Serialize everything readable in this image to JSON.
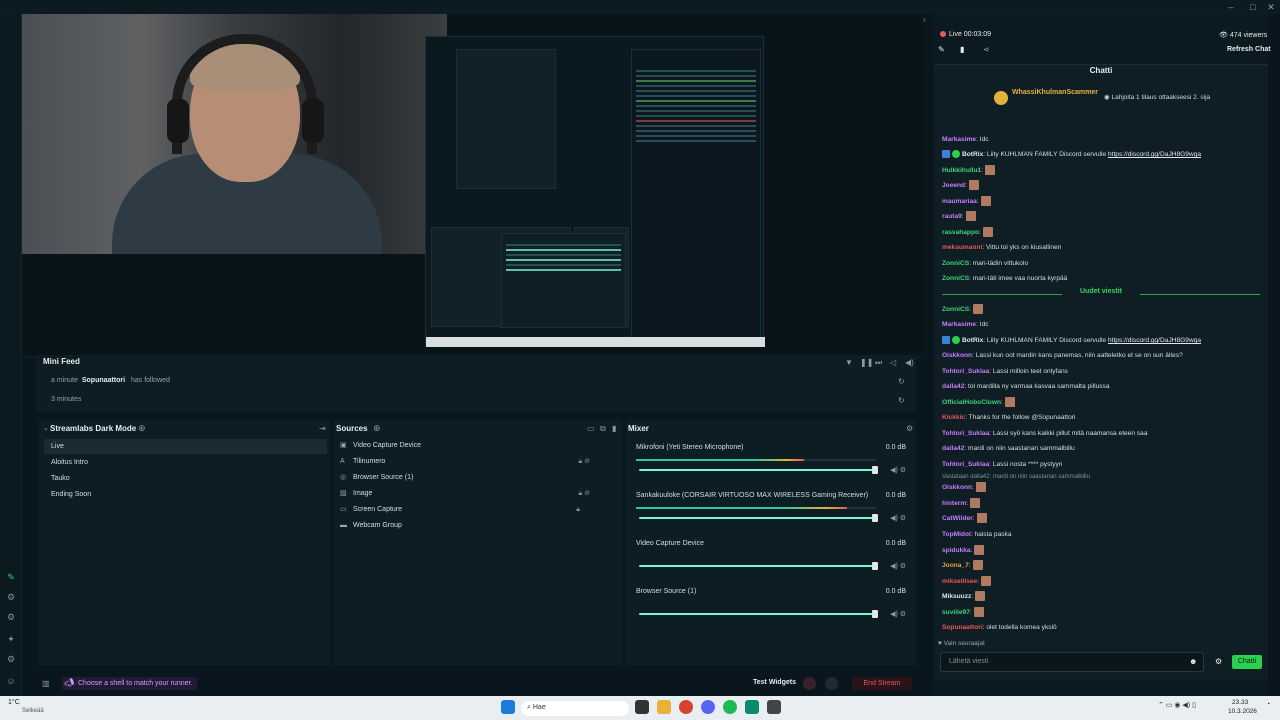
{
  "chat_header": {
    "live_status": "Live 00:03:09",
    "viewers": "474 viewers",
    "refresh": "Refresh Chat",
    "title": "Chatti"
  },
  "pinned": {
    "user": "WhassiKhulmanScammer",
    "message": "Lahjoita 1 tilaus ottaakseesi 2. sija"
  },
  "mini_feed": {
    "title": "Mini Feed",
    "rows": [
      {
        "time": "a minute",
        "user": "Sopunaattori",
        "event": "has followed"
      },
      {
        "time": "3 minutes",
        "user": "",
        "event": ""
      }
    ]
  },
  "scenes": {
    "title": "Streamlabs Dark Mode",
    "items": [
      "Live",
      "Aloitus Intro",
      "Tauko",
      "Ending Soon"
    ]
  },
  "sources": {
    "title": "Sources",
    "items": [
      "Video Capture Device",
      "Tilinumero",
      "Browser Source (1)",
      "Image",
      "Screen Capture",
      "Webcam Group"
    ]
  },
  "mixer": {
    "title": "Mixer",
    "channels": [
      {
        "name": "Mikrofoni (Yeti Stereo Microphone)",
        "db": "0.0 dB",
        "level": 0.7
      },
      {
        "name": "Sankakuuloke (CORSAIR VIRTUOSO MAX WIRELESS Gaming Receiver)",
        "db": "0.0 dB",
        "level": 0.88
      },
      {
        "name": "Video Capture Device",
        "db": "0.0 dB",
        "level": 0
      },
      {
        "name": "Browser Source (1)",
        "db": "0.0 dB",
        "level": 0
      }
    ]
  },
  "bottombar": {
    "tip": "Choose a shell to match your runner.",
    "test_widgets": "Test Widgets",
    "end_stream": "End Stream"
  },
  "chat": {
    "new_messages": "Uudet viestit",
    "lines_before": [
      {
        "user": "Markasime",
        "color": "#c77dff",
        "text": ": Idc"
      },
      {
        "user": "BotRix",
        "color": "#e0e6e9",
        "text": ": Liity KUHLMAN FAMILY Discord servulle ",
        "link": "https://discord.gg/DaJH8G9wga"
      },
      {
        "user": "Hulkkihullu1",
        "color": "#3fd37b",
        "text": ":"
      },
      {
        "user": "Joeend",
        "color": "#c77dff",
        "text": ":"
      },
      {
        "user": "maumariaa",
        "color": "#c77dff",
        "text": ":"
      },
      {
        "user": "rauta9",
        "color": "#c77dff",
        "text": ":"
      },
      {
        "user": "rasvahappo",
        "color": "#3fd37b",
        "text": ":"
      },
      {
        "user": "meksumanni",
        "color": "#e35a5a",
        "text": ": Vittu toi yks on kiusallinen"
      },
      {
        "user": "ZonniCS",
        "color": "#3fd37b",
        "text": ": mari-tädin vittukolo"
      },
      {
        "user": "ZonniCS",
        "color": "#3fd37b",
        "text": ": mari-täti imee vaa nuorta kyrpää"
      }
    ],
    "lines_after": [
      {
        "user": "ZonniCS",
        "color": "#3fd37b",
        "text": ":"
      },
      {
        "user": "Markasime",
        "color": "#c77dff",
        "text": ": Idc"
      },
      {
        "user": "BotRix",
        "color": "#e0e6e9",
        "text": ": Liity KUHLMAN FAMILY Discord servulle ",
        "link": "https://discord.gg/DaJH8G9wga"
      },
      {
        "user": "Oiskkonn",
        "color": "#c77dff",
        "text": ": Lassi kun oot mardin kans panemas, niin aatteletko et se on sun äites?"
      },
      {
        "user": "Tohtori_Suklaa",
        "color": "#c77dff",
        "text": ": Lassi milloin teet onlyfans"
      },
      {
        "user": "dalla42",
        "color": "#c77dff",
        "text": ": tol mardilla ny varmaa kasvaa sammalta pillussa"
      },
      {
        "user": "OfficialHoboClown",
        "color": "#3fd37b",
        "text": ":"
      },
      {
        "user": "Kickkic",
        "color": "#e35a5a",
        "text": ": Thanks for the follow @Sopunaattori"
      },
      {
        "user": "Tohtori_Suklaa",
        "color": "#c77dff",
        "text": ": Lassi syö kans kaikki pillut mitä naamansa eteen saa"
      },
      {
        "user": "dalla42",
        "color": "#c77dff",
        "text": ": mardi on niin saastanan sammalbillu"
      },
      {
        "user": "Tohtori_Suklaa",
        "color": "#c77dff",
        "text": ": Lassi nosta **** pystyyn"
      },
      {
        "user": "Oiskkonn",
        "color": "#c77dff",
        "text": ":"
      },
      {
        "user": "hinterm",
        "color": "#c77dff",
        "text": ":"
      },
      {
        "user": "CatWilder",
        "color": "#c77dff",
        "text": ":"
      },
      {
        "user": "TopMidol",
        "color": "#c77dff",
        "text": ": haista paska"
      },
      {
        "user": "spidukka",
        "color": "#c77dff",
        "text": ":"
      },
      {
        "user": "Joona_7",
        "color": "#e8a33a",
        "text": ":"
      },
      {
        "user": "mikselilsee",
        "color": "#e35a5a",
        "text": ":"
      },
      {
        "user": "Miksuuzz",
        "color": "#e0e6e9",
        "text": ":"
      },
      {
        "user": "suviile97",
        "color": "#3fd37b",
        "text": ":"
      },
      {
        "user": "Sopunaattori",
        "color": "#e35a5a",
        "text": ": olet todella komea ykslö"
      }
    ],
    "reply_hint": "Vastataan dalla42: mardi on niin saastanan sammalbillu",
    "followers_only": "Vain seuraajat",
    "input_placeholder": "Lähetä viesti",
    "send_label": "Chatti"
  },
  "taskbar": {
    "weather": "1°C",
    "weather_sub": "Selkeää",
    "search": "Hae",
    "time": "23.33",
    "date": "10.3.2026"
  }
}
